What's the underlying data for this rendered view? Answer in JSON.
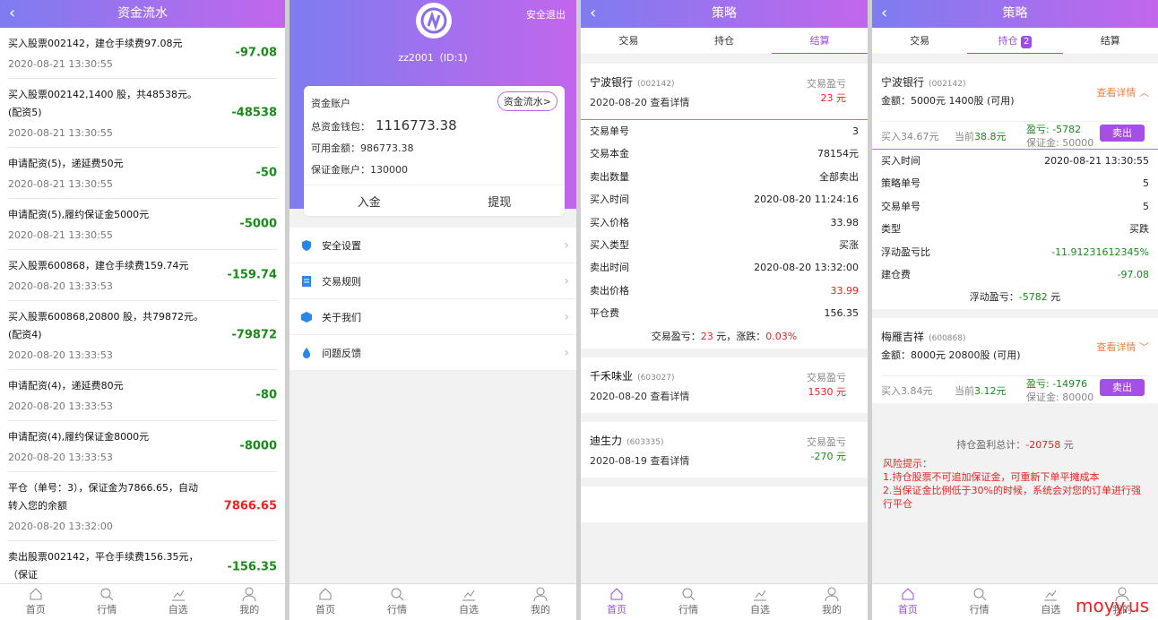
{
  "p1": {
    "title": "资金流水",
    "rows": [
      {
        "t": "买入股票002142，建仓手续费97.08元",
        "d": "2020-08-21 13:30:55",
        "a": "-97.08",
        "red": false
      },
      {
        "t": "买入股票002142,1400 股，共48538元。(配资5)",
        "d": "2020-08-21 13:30:55",
        "a": "-48538",
        "red": false
      },
      {
        "t": "申请配资(5)，递延费50元",
        "d": "2020-08-21 13:30:55",
        "a": "-50",
        "red": false
      },
      {
        "t": "申请配资(5),履约保证金5000元",
        "d": "2020-08-21 13:30:55",
        "a": "-5000",
        "red": false
      },
      {
        "t": "买入股票600868，建仓手续费159.74元",
        "d": "2020-08-20 13:33:53",
        "a": "-159.74",
        "red": false
      },
      {
        "t": "买入股票600868,20800 股，共79872元。(配资4)",
        "d": "2020-08-20 13:33:53",
        "a": "-79872",
        "red": false
      },
      {
        "t": "申请配资(4)，递延费80元",
        "d": "2020-08-20 13:33:53",
        "a": "-80",
        "red": false
      },
      {
        "t": "申请配资(4),履约保证金8000元",
        "d": "2020-08-20 13:33:53",
        "a": "-8000",
        "red": false
      },
      {
        "t": "平仓（单号：3），保证金为7866.65，自动转入您的余额",
        "d": "2020-08-20 13:32:00",
        "a": "7866.65",
        "red": true
      },
      {
        "t": "卖出股票002142，平仓手续费156.35元，（保证",
        "d": "",
        "a": "-156.35",
        "red": false
      }
    ]
  },
  "nav": {
    "home": "首页",
    "quote": "行情",
    "watch": "自选",
    "mine": "我的"
  },
  "p2": {
    "exit": "安全退出",
    "user": "zz2001（ID:1)",
    "acct": "资金账户",
    "flow_btn": "资金流水>",
    "total_label": "总资金钱包：",
    "total": "1116773.38",
    "avail_label": "可用金额：",
    "avail": "986773.38",
    "margin_label": "保证金账户：",
    "margin": "130000",
    "deposit": "入金",
    "withdraw": "提现",
    "menu": [
      "安全设置",
      "交易规则",
      "关于我们",
      "问题反馈"
    ]
  },
  "p3": {
    "title": "策略",
    "tabs": [
      "交易",
      "持仓",
      "结算"
    ],
    "s1": {
      "name": "宁波银行",
      "code": "(002142)",
      "date": "2020-08-20 查看详情",
      "pl_label": "交易盈亏",
      "pl": "23 元"
    },
    "kv": [
      [
        "交易单号",
        "3"
      ],
      [
        "交易本金",
        "78154元"
      ],
      [
        "卖出数量",
        "全部卖出"
      ],
      [
        "买入时间",
        "2020-08-20 11:24:16"
      ],
      [
        "买入价格",
        "33.98"
      ],
      [
        "买入类型",
        "买涨"
      ],
      [
        "卖出时间",
        "2020-08-20 13:32:00"
      ],
      [
        "卖出价格",
        "33.99"
      ],
      [
        "平仓费",
        "156.35"
      ]
    ],
    "sum_a": "交易盈亏：",
    "sum_b": "23",
    "sum_c": " 元，涨跌：",
    "sum_d": "0.03%",
    "s2": {
      "name": "千禾味业",
      "code": "(603027)",
      "date": "2020-08-20 查看详情",
      "pl_label": "交易盈亏",
      "pl": "1530 元"
    },
    "s3": {
      "name": "迪生力",
      "code": "(603335)",
      "date": "2020-08-19 查看详情",
      "pl_label": "交易盈亏",
      "pl": "-270 元"
    }
  },
  "p4": {
    "title": "策略",
    "tabs": [
      "交易",
      "持仓",
      "结算"
    ],
    "badge": "2",
    "a": {
      "name": "宁波银行",
      "code": "(002142)",
      "amt": "金额：5000元 1400股 (可用)",
      "det": "查看详情 ︿",
      "buy": "买入34.67元",
      "cur_l": "当前",
      "cur": "38.8元",
      "pl_l": "盈亏: ",
      "pl": "-5782",
      "mg": "保证金: 50000",
      "sell": "卖出"
    },
    "kv": [
      [
        "买入时间",
        "2020-08-21 13:30:55"
      ],
      [
        "策略单号",
        "5"
      ],
      [
        "交易单号",
        "5"
      ],
      [
        "类型",
        "买跌"
      ],
      [
        "浮动盈亏比",
        "-11.91231612345%"
      ],
      [
        "建仓费",
        "-97.08"
      ]
    ],
    "float_l": "浮动盈亏：",
    "float": "-5782",
    "float_u": " 元",
    "b": {
      "name": "梅雁吉祥",
      "code": "(600868)",
      "amt": "金额：8000元 20800股 (可用)",
      "det": "查看详情 ﹀",
      "buy": "买入3.84元",
      "cur_l": "当前",
      "cur": "3.12元",
      "pl_l": "盈亏: ",
      "pl": "-14976",
      "mg": "保证金: 80000",
      "sell": "卖出"
    },
    "total_l": "持仓盈利总计：",
    "total": "-20758",
    "total_u": " 元",
    "risk": [
      "风险提示：",
      "1.持仓股票不可追加保证金，可重新下单平摊成本",
      "2.当保证金比例低于30%的时候，系统会对您的订单进行强行平仓"
    ]
  },
  "watermark": "moyy.us"
}
